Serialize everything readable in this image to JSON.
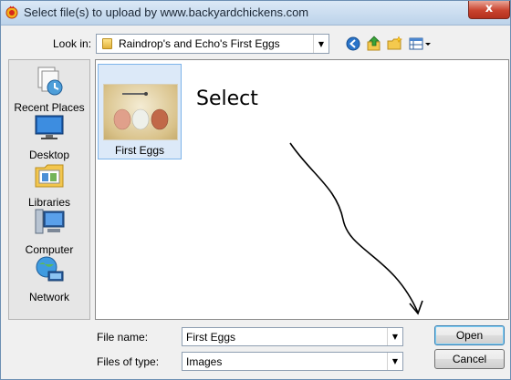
{
  "window": {
    "title": "Select file(s) to upload by www.backyardchickens.com",
    "close_glyph": "x"
  },
  "toolbar": {
    "look_in_label": "Look in:",
    "look_in_value": "Raindrop's and Echo's First Eggs",
    "icons": [
      "back-icon",
      "up-folder-icon",
      "new-folder-icon",
      "view-menu-icon"
    ]
  },
  "places": [
    {
      "label": "Recent Places",
      "icon": "recent-places-icon"
    },
    {
      "label": "Desktop",
      "icon": "desktop-icon"
    },
    {
      "label": "Libraries",
      "icon": "libraries-icon"
    },
    {
      "label": "Computer",
      "icon": "computer-icon"
    },
    {
      "label": "Network",
      "icon": "network-icon"
    }
  ],
  "files": [
    {
      "name": "First Eggs",
      "selected": true
    }
  ],
  "annotation": {
    "text": "Select"
  },
  "bottom": {
    "file_name_label": "File name:",
    "file_name_value": "First Eggs",
    "file_type_label": "Files of type:",
    "file_type_value": "Images",
    "open_label": "Open",
    "cancel_label": "Cancel"
  },
  "colors": {
    "title_bar": "#bcd3ea",
    "close_button": "#c9432e",
    "selection": "#dce9f8"
  }
}
